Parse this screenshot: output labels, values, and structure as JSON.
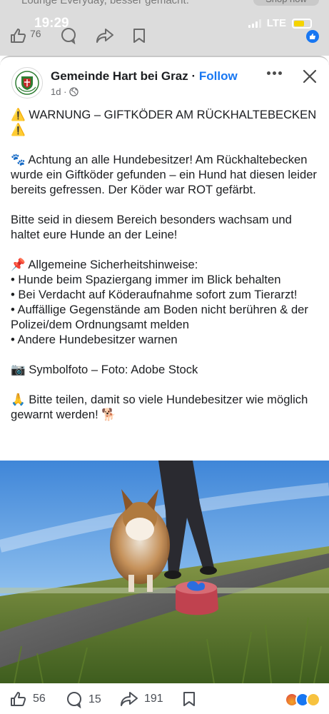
{
  "background_feed": {
    "promo_text": "Lounge Everyday, besser gemacht.",
    "promo_button": "Shop now",
    "like_count": "76"
  },
  "status_bar": {
    "time": "19:29",
    "network": "LTE"
  },
  "post": {
    "page_name": "Gemeinde Hart bei Graz",
    "separator": "·",
    "follow_label": "Follow",
    "age": "1d ·",
    "paragraphs": [
      "⚠️ WARNUNG – GIFTKÖDER AM RÜCKHALTEBECKEN ⚠️",
      "🐾 Achtung an alle Hundebesitzer! Am Rückhaltebecken wurde ein Giftköder gefunden – ein Hund hat diesen leider bereits gefressen. Der Köder war ROT gefärbt.",
      "Bitte seid in diesem Bereich besonders wachsam und haltet eure Hunde an der Leine!",
      "📌 Allgemeine Sicherheitshinweise:",
      "• Hunde beim Spaziergang immer im Blick behalten",
      "• Bei Verdacht auf Köderaufnahme sofort zum Tierarzt!",
      "• Auffällige Gegenstände am Boden nicht berühren & der Polizei/dem Ordnungsamt melden",
      "• Andere Hundebesitzer warnen",
      "📷 Symbolfoto – Foto: Adobe Stock",
      "🙏 Bitte teilen, damit so viele Hundebesitzer wie möglich gewarnt werden! 🐕"
    ],
    "photo_alt": "Dog on a path with a red poison bait in the foreground",
    "footer": {
      "likes": "56",
      "comments": "15",
      "shares": "191"
    }
  },
  "colors": {
    "accent": "#1877f2",
    "text": "#1c1e21",
    "muted": "#65676b"
  }
}
